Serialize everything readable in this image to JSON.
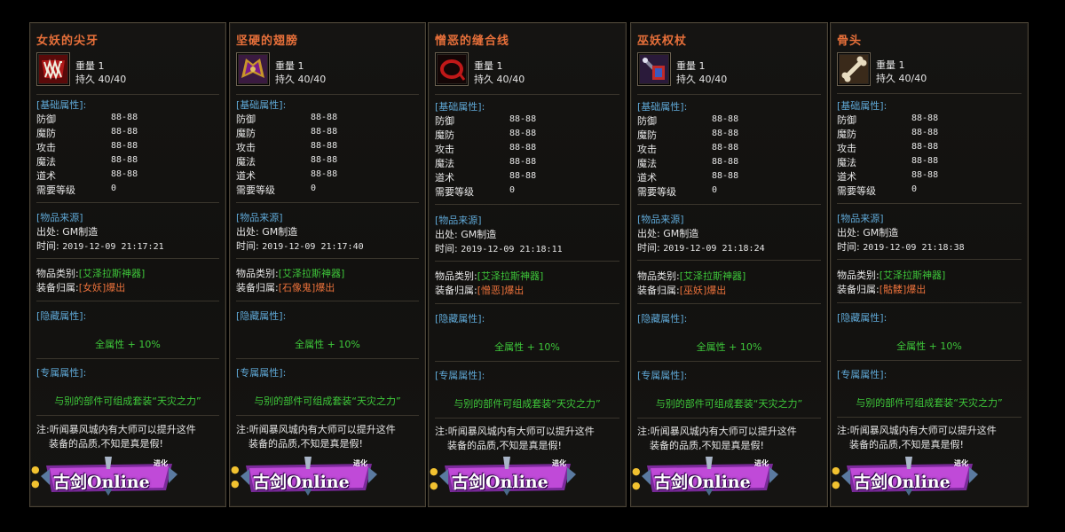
{
  "common": {
    "weight_label": "重量",
    "weight_value": "1",
    "durability_label": "持久",
    "durability_value": "40/40",
    "basic_attr_label": "[基础属性]:",
    "stats": [
      {
        "name": "防御",
        "value": "88-88"
      },
      {
        "name": "魔防",
        "value": "88-88"
      },
      {
        "name": "攻击",
        "value": "88-88"
      },
      {
        "name": "魔法",
        "value": "88-88"
      },
      {
        "name": "道术",
        "value": "88-88"
      },
      {
        "name": "需要等级",
        "value": "0"
      }
    ],
    "source_label": "[物品来源]",
    "origin_label": "出处:",
    "origin_value": "GM制造",
    "time_label": "时间:",
    "category_label": "物品类别:",
    "category_value": "[艾泽拉斯神器]",
    "belong_label": "装备归属:",
    "hidden_label": "[隐藏属性]:",
    "hidden_value": "全属性 + 10%",
    "exclusive_label": "[专属属性]:",
    "set_text": "与别的部件可组成套装“天灾之力”",
    "note_line1": "注:听闻暴风城内有大师可以提升这件",
    "note_line2": "装备的品质,不知是真是假!",
    "logo_text": "古剑Online",
    "logo_sub": "进化",
    "colors": {
      "title": "#e8703a",
      "section": "#5fa8d6",
      "green": "#3ec83a",
      "orange": "#e8703a"
    }
  },
  "items": [
    {
      "name": "女妖的尖牙",
      "icon": "fang-icon",
      "time": "2019-12-09 21:17:21",
      "belong": "[女妖]爆出"
    },
    {
      "name": "坚硬的翅膀",
      "icon": "wing-icon",
      "time": "2019-12-09 21:17:40",
      "belong": "[石像鬼]爆出"
    },
    {
      "name": "憎恶的缝合线",
      "icon": "suture-icon",
      "time": "2019-12-09 21:18:11",
      "belong": "[憎恶]爆出"
    },
    {
      "name": "巫妖权杖",
      "icon": "scepter-icon",
      "time": "2019-12-09 21:18:24",
      "belong": "[巫妖]爆出"
    },
    {
      "name": "骨头",
      "icon": "bone-icon",
      "time": "2019-12-09 21:18:38",
      "belong": "[骷髅]爆出"
    }
  ]
}
